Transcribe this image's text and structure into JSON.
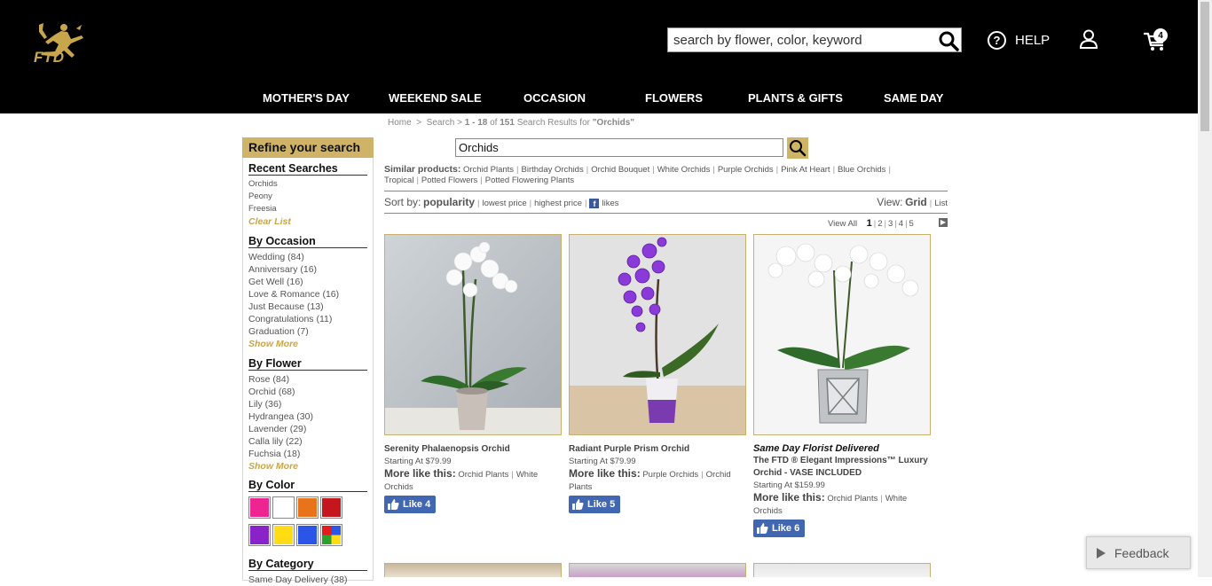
{
  "header": {
    "logo_text": "FTD",
    "search_placeholder": "search by flower, color, keyword",
    "help_label": "HELP",
    "cart_count": "4"
  },
  "nav": [
    "MOTHER'S DAY",
    "WEEKEND SALE",
    "OCCASION",
    "FLOWERS",
    "PLANTS & GIFTS",
    "SAME DAY"
  ],
  "breadcrumb": {
    "home": "Home",
    "separator": ">",
    "search": "Search",
    "range": "1 - 18",
    "of": "of",
    "total": "151",
    "tail": "Search Results for",
    "query": "\"Orchids\""
  },
  "sidebar": {
    "refine_title": "Refine your search",
    "recent": {
      "title": "Recent Searches",
      "items": [
        "Orchids",
        "Peony",
        "Freesia"
      ],
      "clear": "Clear List"
    },
    "occasion": {
      "title": "By Occasion",
      "items": [
        "Wedding (84)",
        "Anniversary (16)",
        "Get Well (16)",
        "Love & Romance (16)",
        "Just Because (13)",
        "Congratulations (11)",
        "Graduation (7)"
      ],
      "more": "Show More"
    },
    "flower": {
      "title": "By Flower",
      "items": [
        "Rose (84)",
        "Orchid (68)",
        "Lily (36)",
        "Hydrangea (30)",
        "Lavender (29)",
        "Calla lily (22)",
        "Fuchsia (18)"
      ],
      "more": "Show More"
    },
    "color": {
      "title": "By Color",
      "swatches": [
        "#ee2490",
        "#ffffff",
        "#e8731a",
        "#c4161c",
        "#8a22c9",
        "#ffdc14",
        "#2a55e6",
        "multi"
      ]
    },
    "category": {
      "title": "By Category",
      "first": "Same Day Delivery (38)"
    }
  },
  "search": {
    "value": "Orchids"
  },
  "similar": {
    "label": "Similar products:",
    "items": [
      "Orchid Plants",
      "Birthday Orchids",
      "Orchid Bouquet",
      "White Orchids",
      "Purple Orchids",
      "Pink At Heart",
      "Blue Orchids",
      "Tropical",
      "Potted Flowers",
      "Potted Flowering Plants"
    ]
  },
  "sort": {
    "label": "Sort by:",
    "active": "popularity",
    "lowest": "lowest price",
    "highest": "highest price",
    "likes": "likes",
    "view_label": "View:",
    "grid": "Grid",
    "list": "List"
  },
  "pager": {
    "view_all": "View All",
    "pages": [
      "1",
      "2",
      "3",
      "4",
      "5"
    ]
  },
  "products": [
    {
      "tag": "",
      "name": "Serenity Phalaenopsis Orchid",
      "price": "Starting At $79.99",
      "more_label": "More like this:",
      "more_links": [
        "Orchid Plants",
        "White Orchids"
      ],
      "like_label": "Like",
      "likes": "4"
    },
    {
      "tag": "",
      "name": "Radiant Purple Prism Orchid",
      "price": "Starting At $79.99",
      "more_label": "More like this:",
      "more_links": [
        "Purple Orchids",
        "Orchid Plants"
      ],
      "like_label": "Like",
      "likes": "5"
    },
    {
      "tag": "Same Day Florist Delivered",
      "name": "The FTD ® Elegant Impressions™ Luxury Orchid - VASE INCLUDED",
      "price": "Starting At $159.99",
      "more_label": "More like this:",
      "more_links": [
        "Orchid Plants",
        "White Orchids"
      ],
      "like_label": "Like",
      "likes": "6"
    }
  ],
  "feedback": {
    "label": "Feedback"
  }
}
